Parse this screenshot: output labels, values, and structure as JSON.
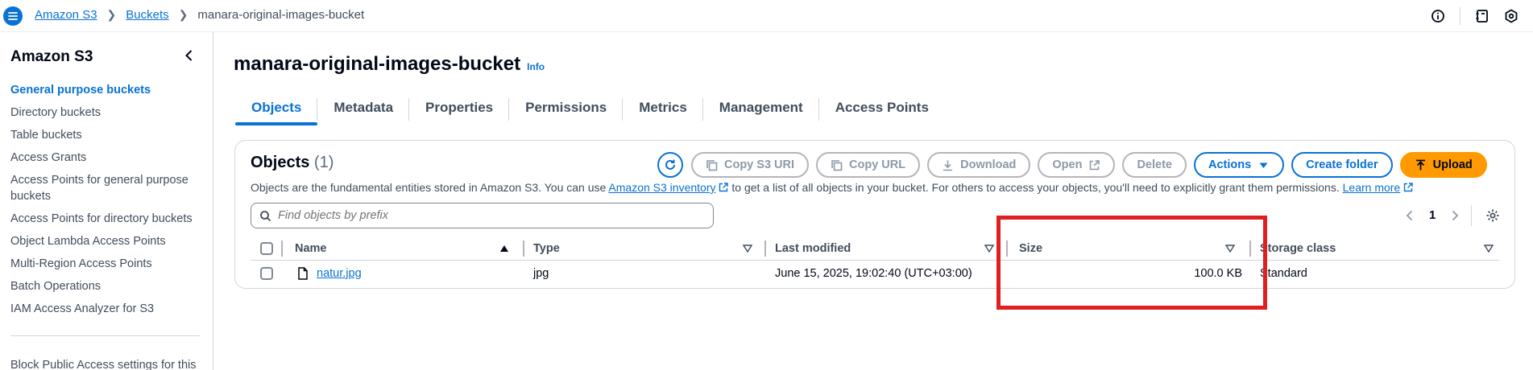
{
  "breadcrumb": [
    {
      "label": "Amazon S3"
    },
    {
      "label": "Buckets"
    },
    {
      "label": "manara-original-images-bucket"
    }
  ],
  "sidebar": {
    "title": "Amazon S3",
    "items": [
      {
        "label": "General purpose buckets",
        "active": true
      },
      {
        "label": "Directory buckets"
      },
      {
        "label": "Table buckets"
      },
      {
        "label": "Access Grants"
      },
      {
        "label": "Access Points for general purpose buckets"
      },
      {
        "label": "Access Points for directory buckets"
      },
      {
        "label": "Object Lambda Access Points"
      },
      {
        "label": "Multi-Region Access Points"
      },
      {
        "label": "Batch Operations"
      },
      {
        "label": "IAM Access Analyzer for S3"
      }
    ],
    "footer_label": "Block Public Access settings for this"
  },
  "page": {
    "title": "manara-original-images-bucket",
    "info_label": "Info"
  },
  "tabs": [
    {
      "label": "Objects",
      "active": true
    },
    {
      "label": "Metadata"
    },
    {
      "label": "Properties"
    },
    {
      "label": "Permissions"
    },
    {
      "label": "Metrics"
    },
    {
      "label": "Management"
    },
    {
      "label": "Access Points"
    }
  ],
  "objects": {
    "title": "Objects",
    "count": "(1)",
    "desc_before": "Objects are the fundamental entities stored in Amazon S3. You can use ",
    "inventory_link": "Amazon S3 inventory",
    "desc_after": " to get a list of all objects in your bucket. For others to access your objects, you'll need to explicitly grant them permissions. ",
    "learn_more": "Learn more",
    "buttons": {
      "copy_s3_uri": "Copy S3 URI",
      "copy_url": "Copy URL",
      "download": "Download",
      "open": "Open",
      "delete": "Delete",
      "actions": "Actions",
      "create_folder": "Create folder",
      "upload": "Upload"
    },
    "search_placeholder": "Find objects by prefix",
    "page_number": "1",
    "columns": {
      "name": "Name",
      "type": "Type",
      "last_modified": "Last modified",
      "size": "Size",
      "storage_class": "Storage class"
    },
    "rows": [
      {
        "name": "natur.jpg",
        "type": "jpg",
        "last_modified": "June 15, 2025, 19:02:40 (UTC+03:00)",
        "size": "100.0 KB",
        "storage_class": "Standard"
      }
    ]
  },
  "colors": {
    "link": "#0972d3",
    "upload": "#ff9900",
    "highlight": "#e02020"
  }
}
